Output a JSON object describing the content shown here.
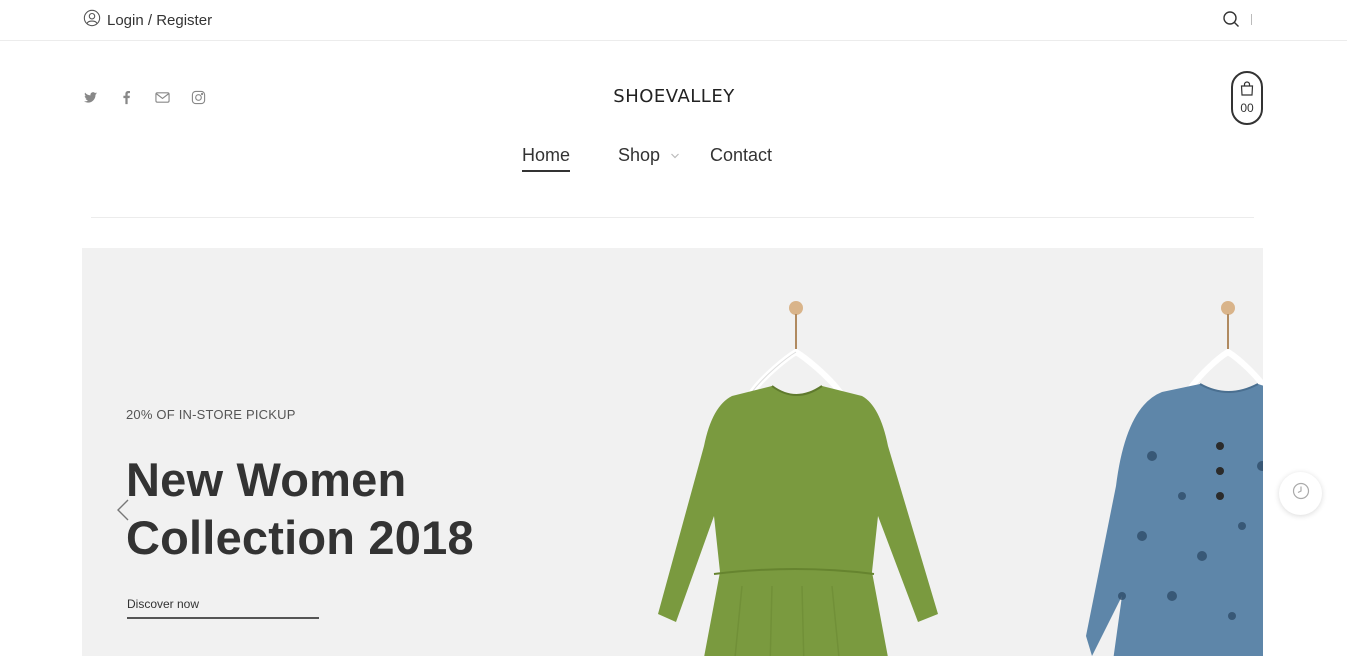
{
  "topbar": {
    "login_label": "Login / Register",
    "icons": [
      "user-icon",
      "search-icon"
    ]
  },
  "header": {
    "logo": "SHOEVALLEY",
    "social_icons": [
      "twitter-icon",
      "facebook-icon",
      "mail-icon",
      "instagram-icon"
    ],
    "cart_count": "00"
  },
  "nav": {
    "items": [
      {
        "label": "Home",
        "active": true
      },
      {
        "label": "Shop",
        "has_dropdown": true
      },
      {
        "label": "Contact"
      }
    ]
  },
  "hero": {
    "subtitle": "20% OF IN-STORE PICKUP",
    "title_line1": "New Women",
    "title_line2": "Collection 2018",
    "cta_label": "Discover now"
  },
  "colors": {
    "text": "#333333",
    "hero_bg": "#f1f1f1",
    "dress_green": "#7a9a3f",
    "dress_blue": "#5e86a9"
  }
}
